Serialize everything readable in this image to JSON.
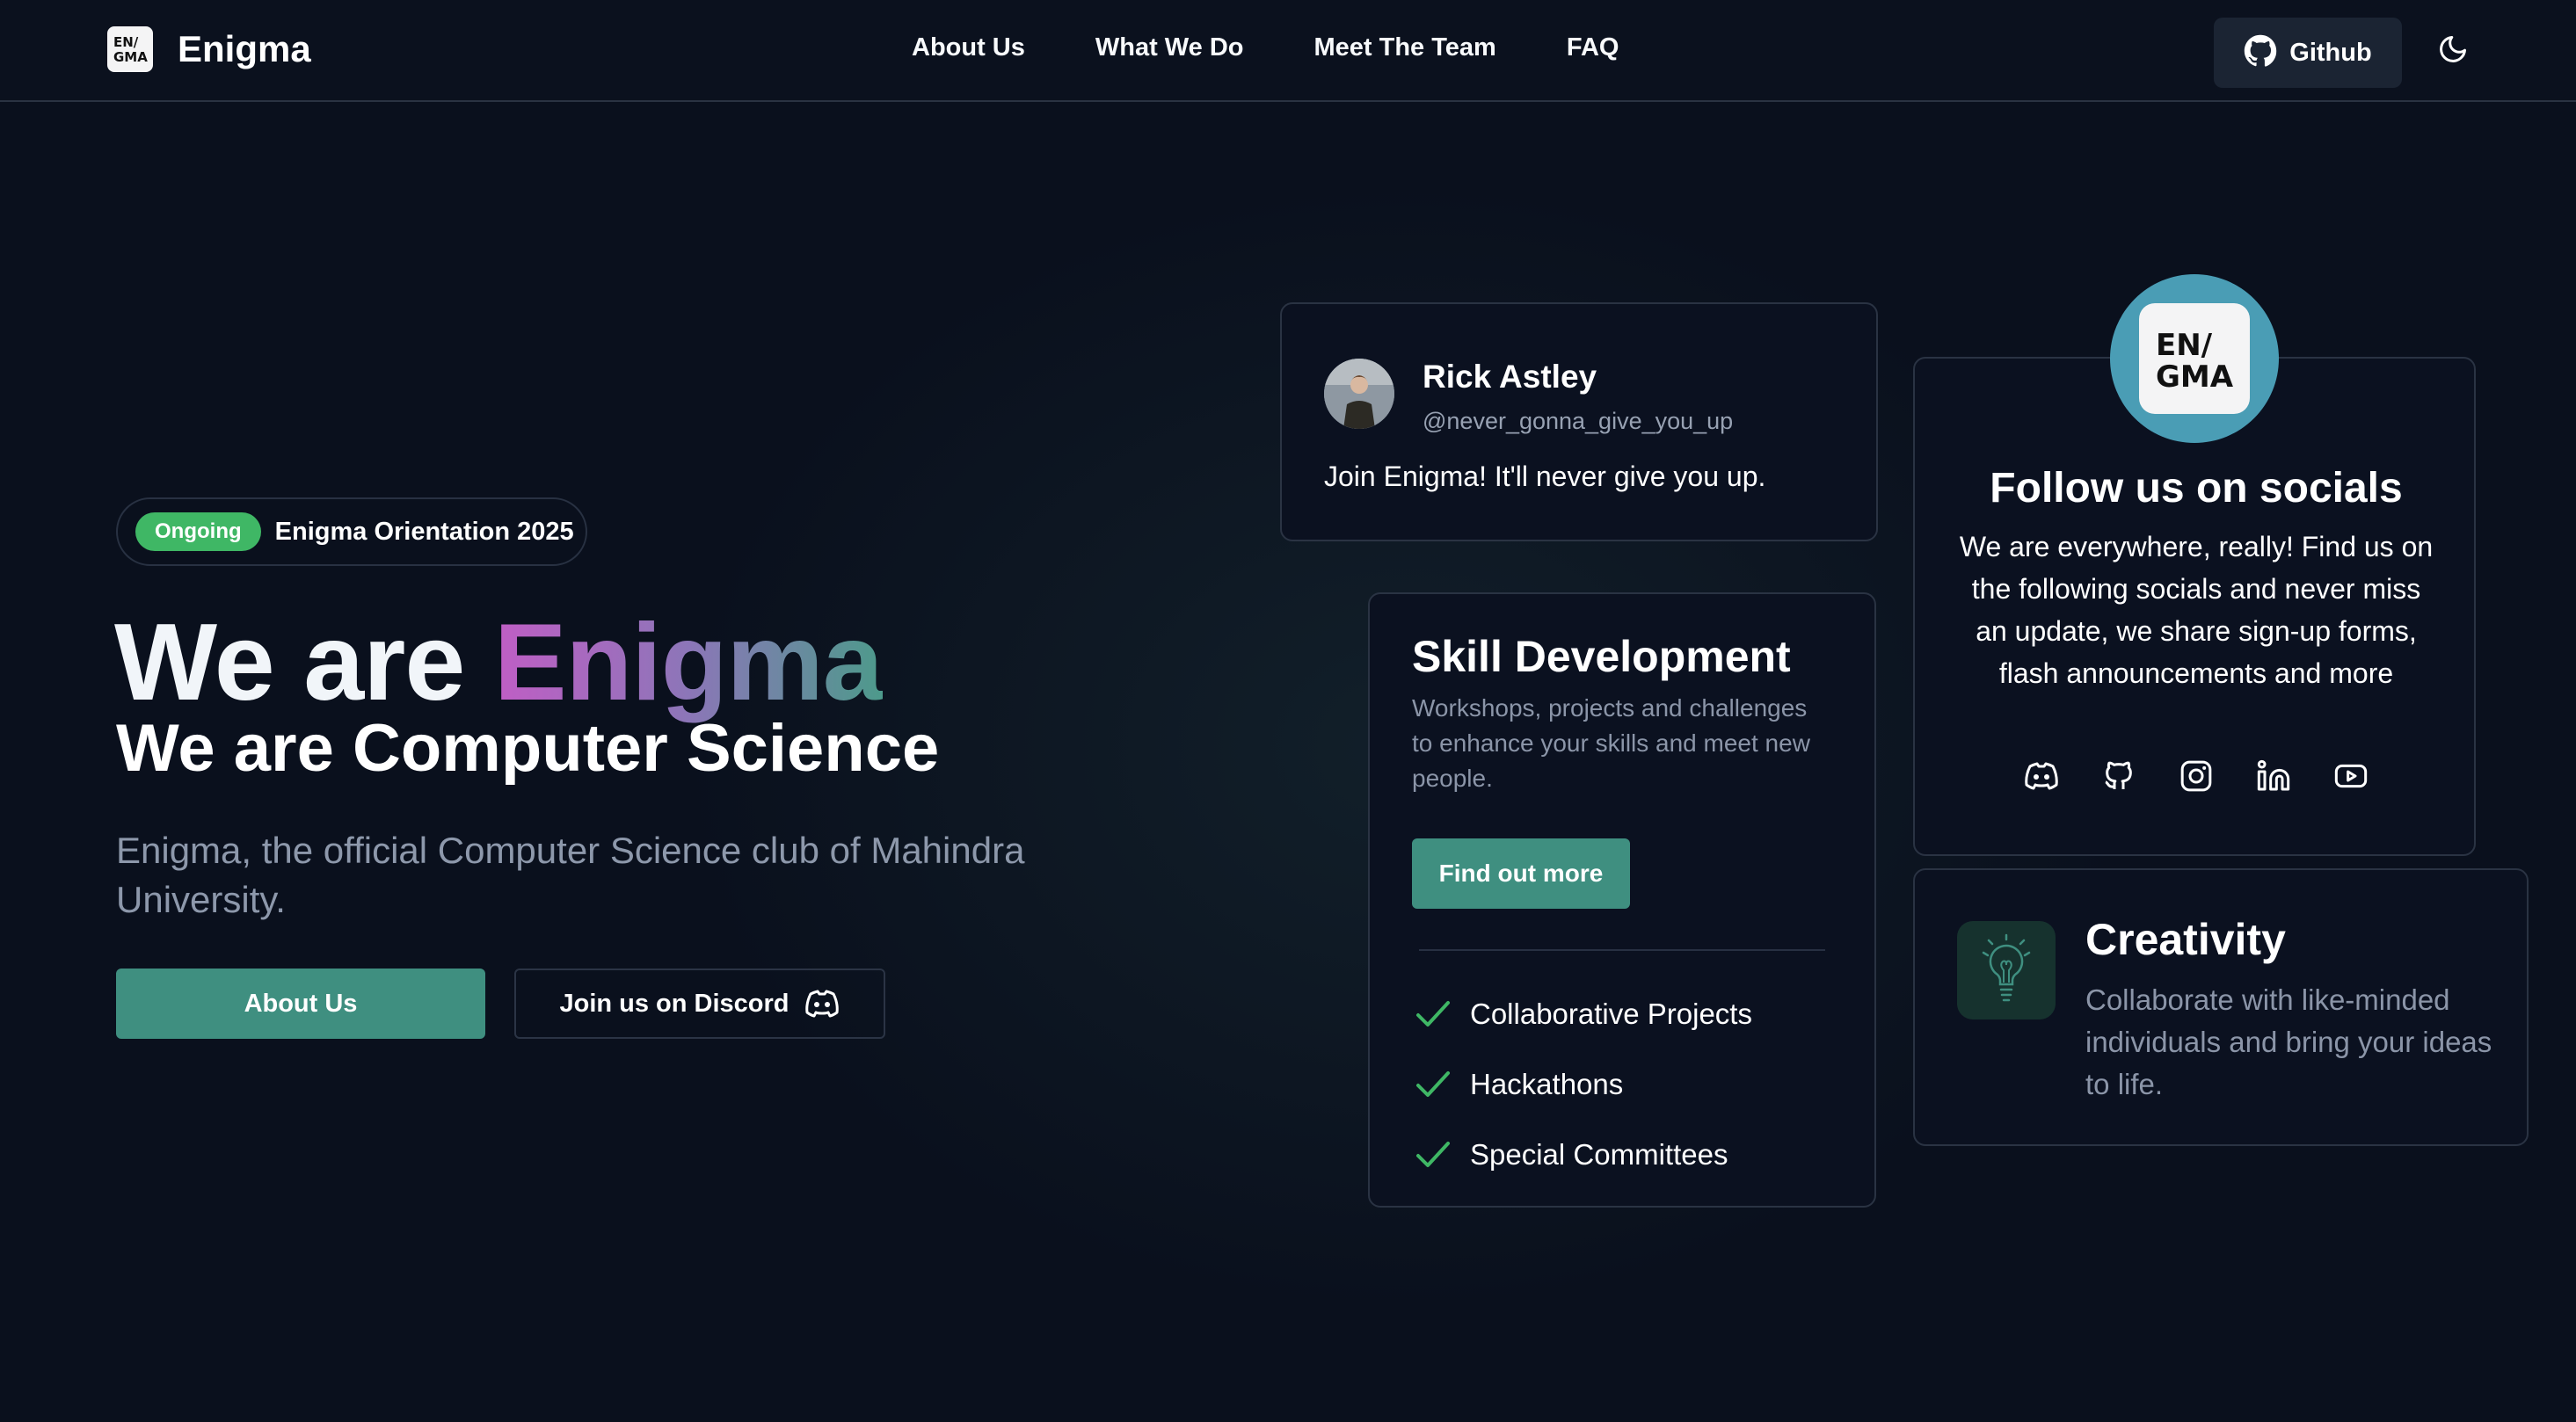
{
  "nav": {
    "brand_name": "Enigma",
    "logo_text_top": "EN/",
    "logo_text_bottom": "GMA",
    "links": [
      "About Us",
      "What We Do",
      "Meet The Team",
      "FAQ"
    ],
    "github_label": "Github",
    "github_icon": "github-icon",
    "theme_icon": "moon-icon"
  },
  "hero": {
    "badge_status": "Ongoing",
    "badge_text": "Enigma Orientation 2025",
    "headline_prefix": "We are ",
    "headline_highlight": "Enigma",
    "subheadline": "We are Computer Science",
    "lead": "Enigma, the official Computer Science club of Mahindra University.",
    "primary_button": "About Us",
    "secondary_button": "Join us on Discord",
    "secondary_icon": "discord-icon"
  },
  "tweet_card": {
    "name": "Rick Astley",
    "handle": "@never_gonna_give_you_up",
    "message": "Join Enigma! It'll never give you up."
  },
  "skill_card": {
    "title": "Skill Development",
    "description": "Workshops, projects and challenges to enhance your skills and meet new people.",
    "button": "Find out more",
    "items": [
      "Collaborative Projects",
      "Hackathons",
      "Special Committees"
    ]
  },
  "social_card": {
    "logo_text_top": "EN/",
    "logo_text_bottom": "GMA",
    "title": "Follow us on socials",
    "description": "We are everywhere, really! Find us on the following socials and never miss an update, we share sign-up forms, flash announcements and more",
    "icons": [
      "discord-icon",
      "github-icon",
      "instagram-icon",
      "linkedin-icon",
      "youtube-icon"
    ]
  },
  "creativity_card": {
    "title": "Creativity",
    "description": "Collaborate with like-minded individuals and bring your ideas to life.",
    "icon": "lightbulb-icon"
  },
  "colors": {
    "background": "#0a101d",
    "accent": "#3f8f80",
    "badge_green": "#3fb765",
    "gradient_start": "#c05ec5",
    "gradient_end": "#4d9a8b",
    "social_logo_bg": "#4a9db5"
  }
}
